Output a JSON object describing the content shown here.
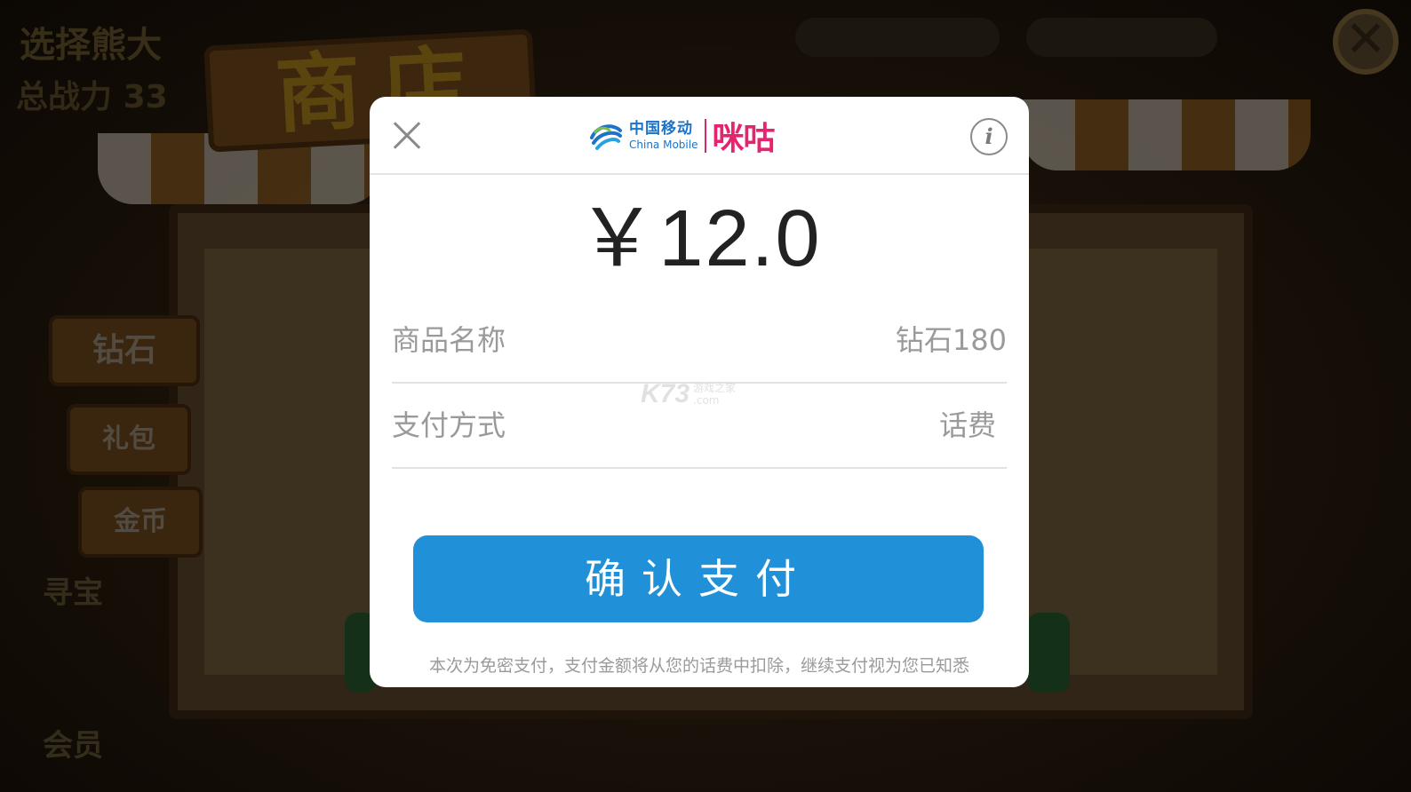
{
  "background": {
    "title": "选择熊大",
    "power_label": "总战力",
    "power_value": "33",
    "shop_sign": "商店",
    "tabs": [
      "钻石",
      "礼包",
      "金币"
    ],
    "side_labels": [
      "寻宝",
      "会员"
    ],
    "close_glyph": "✕"
  },
  "dialog": {
    "brand": {
      "cn": "中国移动",
      "en": "China Mobile",
      "migu": "咪咕"
    },
    "info_glyph": "i",
    "amount": "￥12.0",
    "rows": [
      {
        "label": "商品名称",
        "value": "钻石180"
      },
      {
        "label": "支付方式",
        "value": "话费"
      }
    ],
    "watermark": {
      "main": "K73",
      "sub_top": "游戏之家",
      "sub_bottom": ".com"
    },
    "confirm_label": "确认支付",
    "notice": "本次为免密支付，支付金额将从您的话费中扣除，继续支付视为您已知悉"
  },
  "colors": {
    "confirm_blue": "#2090d8",
    "china_mobile_blue": "#1d73c7",
    "migu_pink": "#e6236f"
  }
}
